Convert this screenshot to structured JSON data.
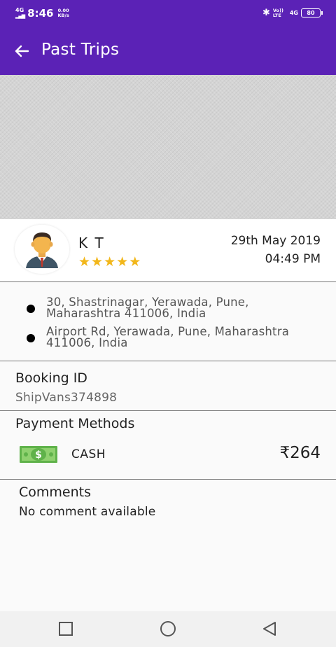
{
  "status_bar": {
    "network": "4G",
    "time": "8:46",
    "speed_value": "0.00",
    "speed_unit": "KB/s",
    "volte": "Vo)) LTE",
    "network_right": "4G",
    "battery": "80"
  },
  "app_bar": {
    "title": "Past Trips",
    "back_icon": "arrow-left-icon"
  },
  "driver": {
    "name": "K T",
    "rating": 5,
    "stars": "★★★★★",
    "date": "29th May 2019",
    "time": "04:49 PM"
  },
  "addresses": {
    "pickup": "30, Shastrinagar, Yerawada, Pune, Maharashtra 411006, India",
    "drop": "Airport Rd, Yerawada, Pune, Maharashtra 411006, India"
  },
  "booking": {
    "label": "Booking ID",
    "id": "ShipVans374898"
  },
  "payment": {
    "label": "Payment Methods",
    "method": "CASH",
    "amount": "₹264",
    "icon": "cash-icon"
  },
  "comments": {
    "label": "Comments",
    "text": "No comment available"
  },
  "colors": {
    "header": "#5b22b6",
    "star": "#f2b71b",
    "cash_green": "#5fb24a"
  }
}
